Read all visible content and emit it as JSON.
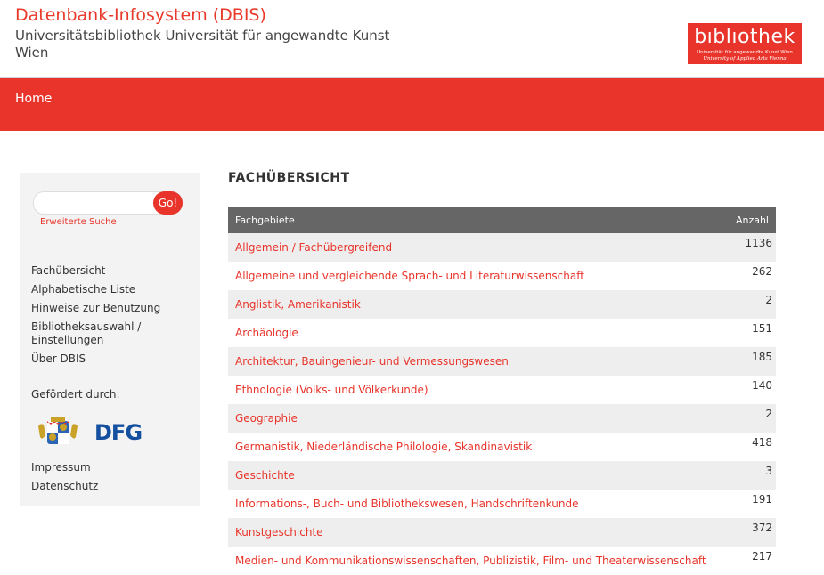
{
  "header": {
    "title": "Datenbank-Infosystem (DBIS)",
    "subtitle": "Universitätsbibliothek Universität für angewandte Kunst Wien",
    "logo": {
      "word": "bıblıothek",
      "line1": "Universität für angewandte Kunst Wien",
      "line2": "University of Applied Arts Vienna"
    }
  },
  "nav": {
    "home": "Home"
  },
  "sidebar": {
    "search_placeholder": "",
    "go_label": "Go!",
    "advanced_search": "Erweiterte Suche",
    "menu": [
      "Fachübersicht",
      "Alphabetische Liste",
      "Hinweise zur Benutzung",
      "Bibliotheksauswahl / Einstellungen",
      "Über DBIS"
    ],
    "funded_label": "Gefördert durch:",
    "dfg_logo": "DFG",
    "footer_links": [
      "Impressum",
      "Datenschutz"
    ]
  },
  "content": {
    "title": "FACHÜBERSICHT",
    "columns": [
      "Fachgebiete",
      "Anzahl"
    ],
    "rows": [
      {
        "name": "Allgemein / Fachübergreifend",
        "count": "1136"
      },
      {
        "name": "Allgemeine und vergleichende Sprach- und Literaturwissenschaft",
        "count": "262"
      },
      {
        "name": "Anglistik, Amerikanistik",
        "count": "2"
      },
      {
        "name": "Archäologie",
        "count": "151"
      },
      {
        "name": "Architektur, Bauingenieur- und Vermessungswesen",
        "count": "185"
      },
      {
        "name": "Ethnologie (Volks- und Völkerkunde)",
        "count": "140"
      },
      {
        "name": "Geographie",
        "count": "2"
      },
      {
        "name": "Germanistik, Niederländische Philologie, Skandinavistik",
        "count": "418"
      },
      {
        "name": "Geschichte",
        "count": "3"
      },
      {
        "name": "Informations-, Buch- und Bibliothekswesen, Handschriftenkunde",
        "count": "191"
      },
      {
        "name": "Kunstgeschichte",
        "count": "372"
      },
      {
        "name": "Medien- und Kommunikationswissenschaften, Publizistik, Film- und Theaterwissenschaft",
        "count": "217"
      }
    ]
  },
  "colors": {
    "accent": "#e8342a",
    "table_header": "#666666",
    "sidebar_bg": "#f3f3f3"
  }
}
